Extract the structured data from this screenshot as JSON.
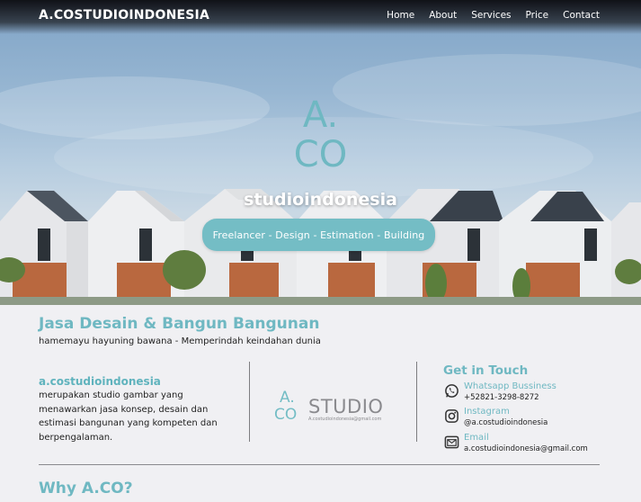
{
  "navbar": {
    "brand": "A.COSTUDIOINDONESIA",
    "links": [
      "Home",
      "About",
      "Services",
      "Price",
      "Contact"
    ]
  },
  "hero": {
    "logo_a": "A.",
    "logo_co": "CO",
    "subtitle": "studioindonesia",
    "tagline": "Freelancer - Design - Estimation - Building"
  },
  "intro": {
    "title": "Jasa Desain & Bangun Bangunan",
    "tagline": "hamemayu hayuning bawana - Memperindah keindahan dunia"
  },
  "about": {
    "name": "a.costudioindonesia",
    "description": "merupakan studio gambar yang menawarkan jasa konsep, desain dan estimasi bangunan yang kompeten dan berpengalaman."
  },
  "studio_logo": {
    "a": "A.",
    "co": "CO",
    "word": "STUDIO",
    "email": "A.costudioindonesia@gmail.com"
  },
  "contact": {
    "title": "Get in Touch",
    "items": [
      {
        "icon": "whatsapp-icon",
        "label": "Whatsapp Bussiness",
        "value": "+52821-3298-8272"
      },
      {
        "icon": "instagram-icon",
        "label": "Instagram",
        "value": "@a.costudioindonesia"
      },
      {
        "icon": "email-icon",
        "label": "Email",
        "value": "a.costudioindonesia@gmail.com"
      }
    ]
  },
  "why": {
    "title": "Why A.CO?"
  },
  "colors": {
    "accent": "#6fb8c2",
    "pill": "#74bdc5",
    "background": "#f0f0f3"
  }
}
